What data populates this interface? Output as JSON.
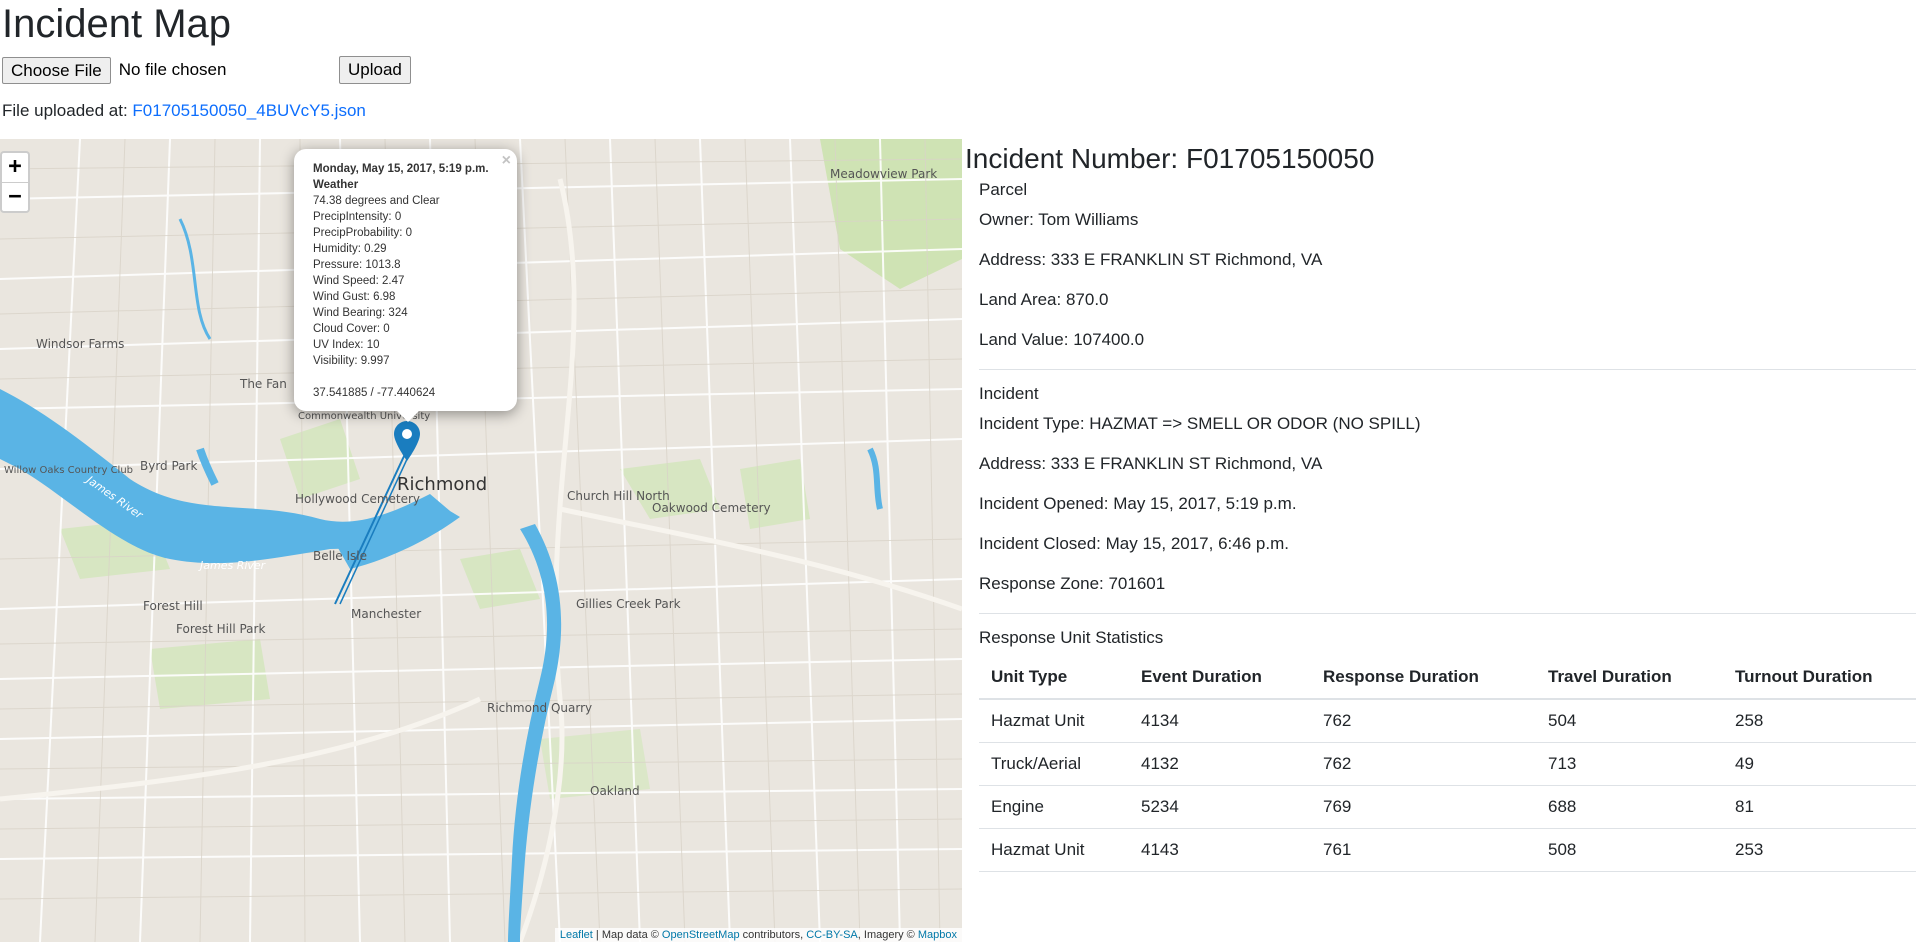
{
  "page": {
    "title": "Incident Map"
  },
  "upload": {
    "choose_label": "Choose File",
    "no_file_text": "No file chosen",
    "upload_label": "Upload",
    "uploaded_prefix": "File uploaded at: ",
    "uploaded_file": "F01705150050_4BUVcY5.json"
  },
  "map": {
    "zoom_in": "+",
    "zoom_out": "−",
    "popup": {
      "close": "×",
      "datetime": "Monday, May 15, 2017, 5:19 p.m.",
      "weather_heading": "Weather",
      "lines": [
        "74.38 degrees and Clear",
        "PrecipIntensity: 0",
        "PrecipProbability: 0",
        "Humidity: 0.29",
        "Pressure: 1013.8",
        "Wind Speed: 2.47",
        "Wind Gust: 6.98",
        "Wind Bearing: 324",
        "Cloud Cover: 0",
        "UV Index: 10",
        "Visibility: 9.997"
      ],
      "coords": "37.541885 / -77.440624"
    },
    "labels": {
      "city": "Richmond",
      "hoods": [
        "Meadowview Park",
        "Windsor Farms",
        "The Fan",
        "Byrd Park",
        "Hollywood Cemetery",
        "Church Hill North",
        "Oakwood Cemetery",
        "Belle Isle",
        "Forest Hill",
        "Forest Hill Park",
        "Manchester",
        "Gillies Creek Park",
        "Richmond Quarry",
        "Oakland",
        "Willow Oaks Country Club",
        "Commonwealth University"
      ],
      "water": [
        "James River",
        "James River"
      ]
    },
    "attribution": {
      "leaflet": "Leaflet",
      "mapdata": " | Map data © ",
      "osm": "OpenStreetMap",
      "contributors": " contributors, ",
      "license": "CC-BY-SA",
      "imagery": ", Imagery © ",
      "mapbox": "Mapbox"
    },
    "colors": {
      "water": "#5ab4e5",
      "land": "#eae6df",
      "park": "#cfe3b4",
      "road": "#ffffff",
      "marker": "#1a7dbf"
    }
  },
  "incident": {
    "title": "Incident Number: F01705150050",
    "parcel": {
      "heading": "Parcel",
      "owner": "Owner: Tom Williams",
      "address": "Address: 333 E FRANKLIN ST Richmond, VA",
      "land_area": "Land Area: 870.0",
      "land_value": "Land Value: 107400.0"
    },
    "details": {
      "heading": "Incident",
      "type": "Incident Type: HAZMAT => SMELL OR ODOR (NO SPILL)",
      "address": "Address: 333 E FRANKLIN ST Richmond, VA",
      "opened": "Incident Opened: May 15, 2017, 5:19 p.m.",
      "closed": "Incident Closed: May 15, 2017, 6:46 p.m.",
      "zone": "Response Zone: 701601"
    },
    "units": {
      "heading": "Response Unit Statistics",
      "columns": [
        "Unit Type",
        "Event Duration",
        "Response Duration",
        "Travel Duration",
        "Turnout Duration"
      ],
      "rows": [
        [
          "Hazmat Unit",
          "4134",
          "762",
          "504",
          "258"
        ],
        [
          "Truck/Aerial",
          "4132",
          "762",
          "713",
          "49"
        ],
        [
          "Engine",
          "5234",
          "769",
          "688",
          "81"
        ],
        [
          "Hazmat Unit",
          "4143",
          "761",
          "508",
          "253"
        ]
      ]
    }
  }
}
